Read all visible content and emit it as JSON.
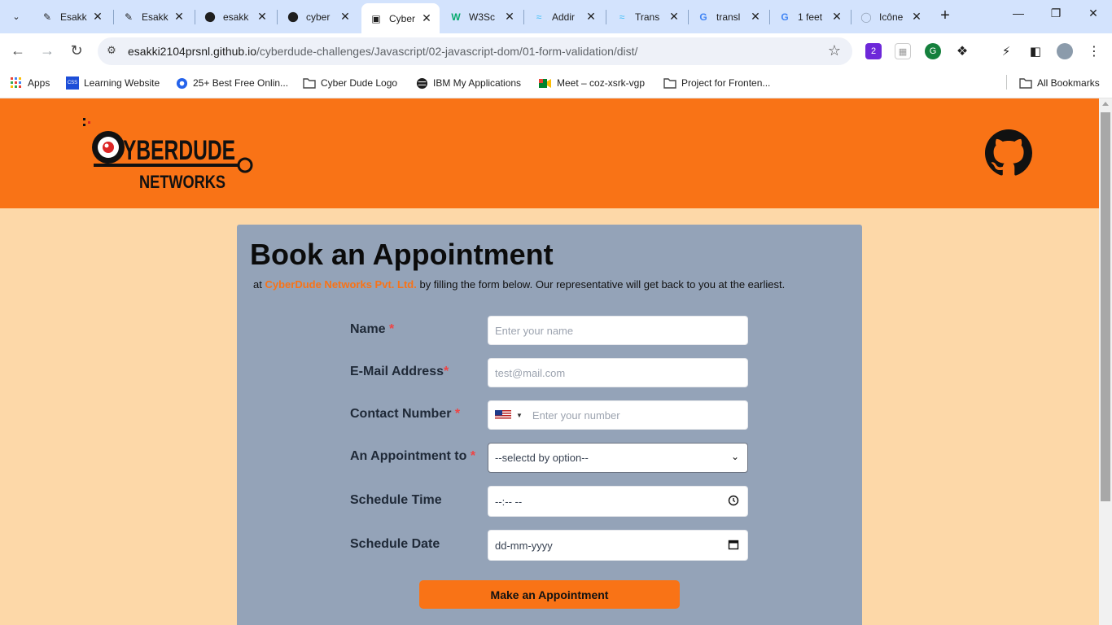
{
  "browser": {
    "tabs": [
      {
        "title": "Esakk",
        "icon": "chat-icon"
      },
      {
        "title": "Esakk",
        "icon": "chat-icon"
      },
      {
        "title": "esakk",
        "icon": "github-icon"
      },
      {
        "title": "cyber",
        "icon": "github-icon"
      },
      {
        "title": "Cyber",
        "icon": "page-icon",
        "active": true
      },
      {
        "title": "W3Sc",
        "icon": "w3schools-icon"
      },
      {
        "title": "Addir",
        "icon": "tailwind-icon"
      },
      {
        "title": "Trans",
        "icon": "tailwind-icon"
      },
      {
        "title": "transl",
        "icon": "google-icon"
      },
      {
        "title": "1 feet",
        "icon": "google-icon"
      },
      {
        "title": "Icône",
        "icon": "drop-icon"
      }
    ],
    "url_host": "esakki2104prsnl.github.io",
    "url_path": "/cyberdude-challenges/Javascript/02-javascript-dom/01-form-validation/dist/",
    "bookmarks": [
      {
        "label": "Apps",
        "icon": "apps-grid-icon"
      },
      {
        "label": "Learning Website",
        "icon": "css-grid-icon"
      },
      {
        "label": "25+ Best Free Onlin...",
        "icon": "blue-circle-icon"
      },
      {
        "label": "Cyber Dude Logo",
        "icon": "folder-icon"
      },
      {
        "label": "IBM My Applications",
        "icon": "globe-icon"
      },
      {
        "label": "Meet – coz-xsrk-vgp",
        "icon": "meet-icon"
      },
      {
        "label": "Project for Fronten...",
        "icon": "folder-icon"
      }
    ],
    "all_bookmarks": "All Bookmarks"
  },
  "header": {
    "logo_line1": "YBERDUDE",
    "logo_line2": "NETWORKS",
    "colors": {
      "brand": "#f97316",
      "page_bg": "#fdd8a8",
      "card_bg": "#94a3b8"
    }
  },
  "form": {
    "title": "Book an Appointment",
    "subtitle_prefix": "at",
    "subtitle_brand": "CyberDude Networks Pvt. Ltd.",
    "subtitle_suffix": "by filling the form below. Our representative will get back to you at the earliest.",
    "name_label": "Name",
    "name_placeholder": "Enter your name",
    "email_label": "E-Mail Address",
    "email_placeholder": "test@mail.com",
    "contact_label": "Contact Number",
    "contact_placeholder": "Enter your number",
    "appointment_label": "An Appointment to",
    "appointment_selected": "--selectd by option--",
    "time_label": "Schedule Time",
    "time_value": "--:-- --",
    "date_label": "Schedule Date",
    "date_value": "dd-mm-yyyy",
    "required_mark": "*",
    "submit_label": "Make an Appointment"
  }
}
